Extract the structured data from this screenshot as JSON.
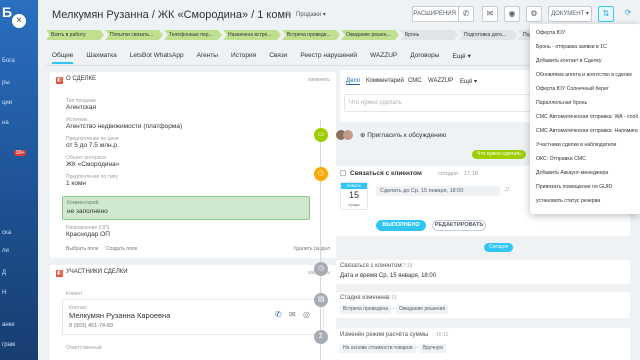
{
  "left_strip": {
    "items": [
      "Бога",
      "ры",
      "ции",
      "на",
      "ска",
      "ли",
      "Д",
      "Н",
      "анке",
      "грам"
    ],
    "badge": "99+"
  },
  "header": {
    "title": "Мелкумян Рузанна / ЖК «Смородина» / 1 комн",
    "stage_link": "Продажи",
    "btn_expand": "РАСШИРЕНИЯ",
    "btn_document": "ДОКУМЕНТ"
  },
  "stages": [
    {
      "label": "Взять в работу",
      "color": "#bfe08f"
    },
    {
      "label": "Попытки связать...",
      "color": "#bfe08f"
    },
    {
      "label": "Телефонные пер...",
      "color": "#bfe08f"
    },
    {
      "label": "Назначена встре...",
      "color": "#bfe08f"
    },
    {
      "label": "Встреча проведе...",
      "color": "#bfe08f"
    },
    {
      "label": "Ожидание решен...",
      "color": "#bfe08f"
    },
    {
      "label": "Бронь",
      "color": "#e0e4e7"
    },
    {
      "label": "Подготовка дого...",
      "color": "#e0e4e7"
    },
    {
      "label": "Подписание...",
      "color": "#e0e4e7"
    }
  ],
  "tabs": [
    "Общие",
    "Шахматка",
    "LetsBot WhatsApp",
    "Агенты",
    "История",
    "Связи",
    "Реестр нарушений",
    "WAZZUP",
    "Договоры",
    "Ещё"
  ],
  "about_card": {
    "title": "О СДЕЛКЕ",
    "edit": "изменить",
    "fields": [
      {
        "label": "Тип продажи",
        "value": "Агентская"
      },
      {
        "label": "Источник",
        "value": "Агентство недвижимости (платформа)"
      },
      {
        "label": "Предпочтение по цене",
        "value": "от 5 до 7.5 млн.р."
      },
      {
        "label": "Объект интереса",
        "value": "ЖК «Смородина»"
      },
      {
        "label": "Предпочтение по типу",
        "value": "1 комн"
      }
    ],
    "comment_label": "Комментарий",
    "comment_value": "не заполнено",
    "direction_label": "Направление (ОП)",
    "direction_value": "Краснодар ОП",
    "choose_field": "Выбрать поле",
    "create_field": "Создать поле",
    "delete_section": "Удалить раздел"
  },
  "participants_card": {
    "title": "УЧАСТНИКИ СДЕЛКИ",
    "edit": "изменить",
    "client_label": "Клиент",
    "contact_label": "Контакт",
    "contact_name": "Мелкумян Рузанна Кароевна",
    "contact_phone": "8 (903) 451-74-89",
    "responsible_label": "Ответственный"
  },
  "composer": {
    "tabs": [
      "Дело",
      "Комментарий",
      "СМС",
      "WAZZUP",
      "Ещё"
    ],
    "placeholder": "Что нужно сделать",
    "invite": "Пригласить к обсуждению"
  },
  "timeline": {
    "todo_pill": "Что нужно сделать",
    "today_pill": "Сегодня",
    "task_title": "Связаться с клиентом",
    "task_when": "сегодня",
    "task_time": "17:18",
    "task_deadline": "Сделать до Ср, 15 января, 18:00",
    "cal_month": "ЯНВАРЬ",
    "cal_day": "15",
    "cal_weekday": "среда",
    "btn_done": "ВЫПОЛНЕНО",
    "btn_edit": "РЕДАКТИРОВАТЬ",
    "event1_title": "Связаться с клиентом",
    "event1_time": "17:18",
    "event1_body": "Дата и время Ср, 15 января, 18:00",
    "event2_title": "Стадия изменена",
    "event2_time": "16:13",
    "event2_from": "Встреча проведена",
    "event2_to": "Ожидание решения",
    "event3_title": "Изменён режим расчёта суммы",
    "event3_time": "16:12",
    "event3_from": "На основе стоимости товаров",
    "event3_to": "Вручную"
  },
  "menu": {
    "items": [
      "Оферта ЮУ",
      "Бронь - отправка заявки в 1С",
      "Добавить контакт в Сделку",
      "Обновляем агента и агентство в сделке",
      "Оферта ЮУ Солнечный берег",
      "Параллельная бронь",
      "СМС Автоматическая отправка: WA - сооб...",
      "СМС Автоматическая отправка: Напоминани...",
      "Участники сделки в наблюдатели",
      "ОКС: Отправка СМС",
      "Добавить Аккаунт-менеджера",
      "Привязать помещение по GUID",
      "установить статус резерва"
    ]
  }
}
